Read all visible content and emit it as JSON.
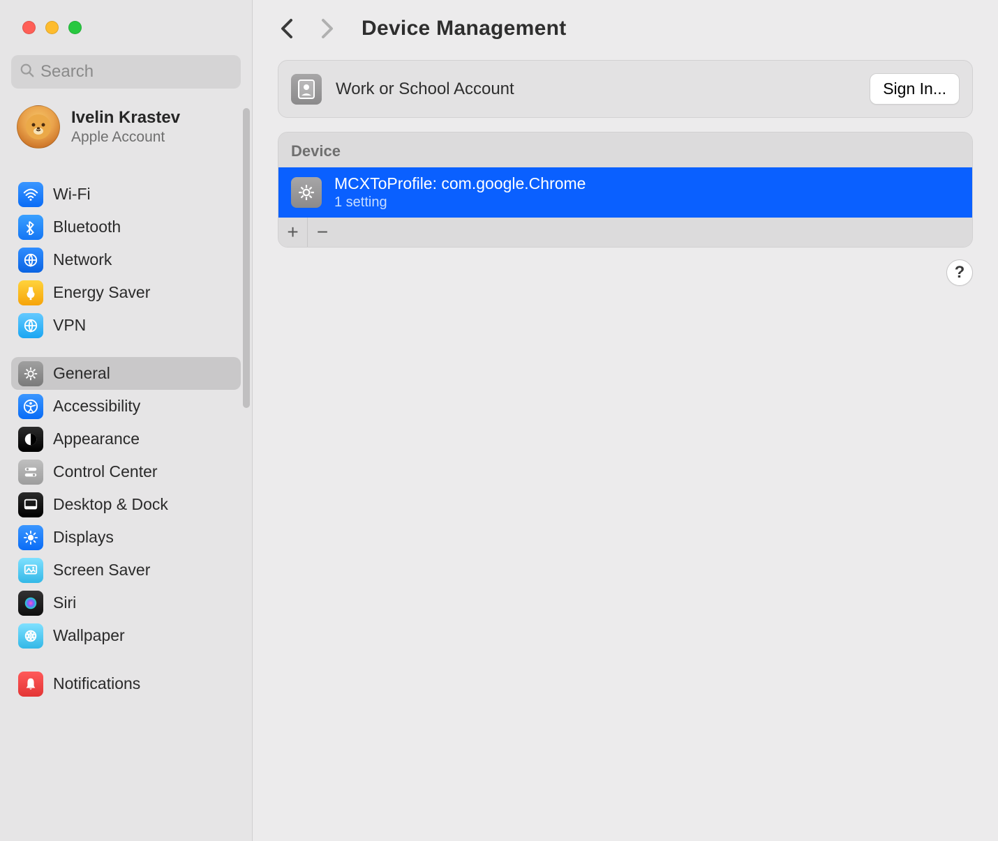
{
  "window_controls": {
    "close": "close",
    "minimize": "minimize",
    "maximize": "maximize"
  },
  "search": {
    "placeholder": "Search"
  },
  "account": {
    "name": "Ivelin Krastev",
    "subtitle": "Apple Account"
  },
  "sidebar": {
    "groups": [
      {
        "items": [
          {
            "label": "Wi-Fi",
            "icon": "wifi-icon",
            "color": "ic-blue"
          },
          {
            "label": "Bluetooth",
            "icon": "bluetooth-icon",
            "color": "ic-blue2"
          },
          {
            "label": "Network",
            "icon": "network-icon",
            "color": "ic-blue3"
          },
          {
            "label": "Energy Saver",
            "icon": "energy-icon",
            "color": "ic-yellow"
          },
          {
            "label": "VPN",
            "icon": "vpn-icon",
            "color": "ic-teal"
          }
        ]
      },
      {
        "items": [
          {
            "label": "General",
            "icon": "gear-icon",
            "color": "ic-gray",
            "selected": true
          },
          {
            "label": "Accessibility",
            "icon": "accessibility-icon",
            "color": "ic-blue"
          },
          {
            "label": "Appearance",
            "icon": "appearance-icon",
            "color": "ic-black"
          },
          {
            "label": "Control Center",
            "icon": "switches-icon",
            "color": "ic-ltgray"
          },
          {
            "label": "Desktop & Dock",
            "icon": "dock-icon",
            "color": "ic-black"
          },
          {
            "label": "Displays",
            "icon": "display-icon",
            "color": "ic-blue"
          },
          {
            "label": "Screen Saver",
            "icon": "screensaver-icon",
            "color": "ic-cyan"
          },
          {
            "label": "Siri",
            "icon": "siri-icon",
            "color": "ic-dark"
          },
          {
            "label": "Wallpaper",
            "icon": "wallpaper-icon",
            "color": "ic-cyan"
          }
        ]
      },
      {
        "items": [
          {
            "label": "Notifications",
            "icon": "notifications-icon",
            "color": "ic-red"
          }
        ]
      }
    ]
  },
  "header": {
    "title": "Device Management"
  },
  "work_account_card": {
    "title": "Work or School Account",
    "button": "Sign In..."
  },
  "device_list": {
    "section_label": "Device",
    "profiles": [
      {
        "title": "MCXToProfile: com.google.Chrome",
        "subtitle": "1 setting",
        "selected": true
      }
    ],
    "add_label": "+",
    "remove_label": "−"
  },
  "help_label": "?"
}
